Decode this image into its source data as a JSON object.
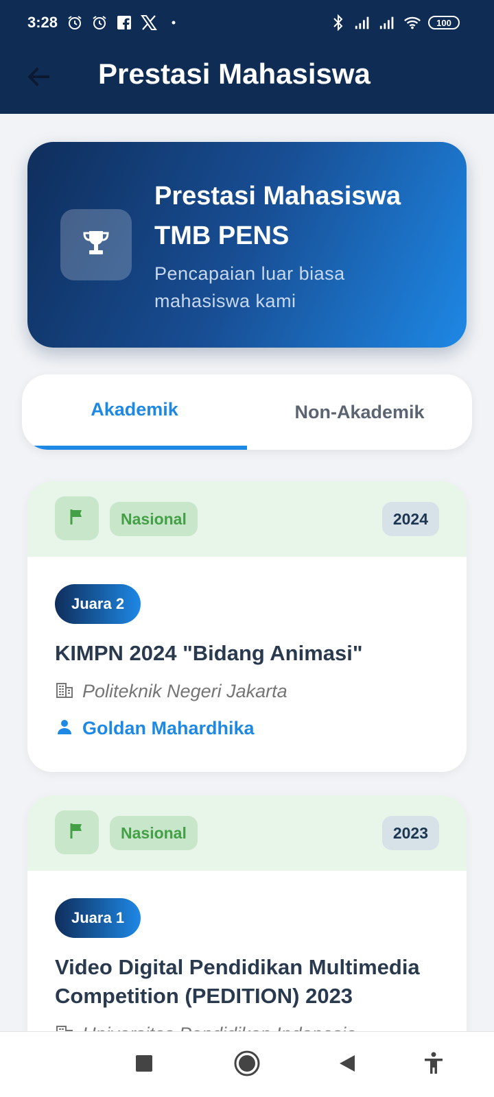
{
  "status_bar": {
    "time": "3:28",
    "battery": "100",
    "left_icons": [
      "alarm-icon",
      "alarm-icon",
      "facebook-icon",
      "x-icon",
      "dot-icon"
    ],
    "right_icons": [
      "bluetooth-icon",
      "signal-icon",
      "signal-icon",
      "wifi-icon"
    ]
  },
  "header": {
    "title": "Prestasi Mahasiswa",
    "back_icon": "arrow-left-icon"
  },
  "hero": {
    "title": "Prestasi Mahasiswa TMB PENS",
    "subtitle": "Pencapaian luar biasa mahasiswa kami",
    "icon": "trophy-icon"
  },
  "tabs": [
    {
      "label": "Akademik",
      "active": true
    },
    {
      "label": "Non-Akademik",
      "active": false
    }
  ],
  "achievements": [
    {
      "level": "Nasional",
      "year": "2024",
      "rank": "Juara 2",
      "title": "KIMPN 2024 \"Bidang Animasi\"",
      "venue": "Politeknik Negeri Jakarta",
      "student": "Goldan Mahardhika"
    },
    {
      "level": "Nasional",
      "year": "2023",
      "rank": "Juara 1",
      "title": "Video Digital Pendidikan Multimedia Competition (PEDITION) 2023",
      "venue": "Universitas Pendidikan Indonesia"
    }
  ],
  "colors": {
    "header_bg": "#0f2c54",
    "accent": "#1e88e5",
    "level_green": "#43a047",
    "level_bg": "#c8e6c9"
  },
  "nav_bar": {
    "icons": [
      "square-icon",
      "home-circle-icon",
      "back-triangle-icon",
      "accessibility-icon"
    ]
  }
}
